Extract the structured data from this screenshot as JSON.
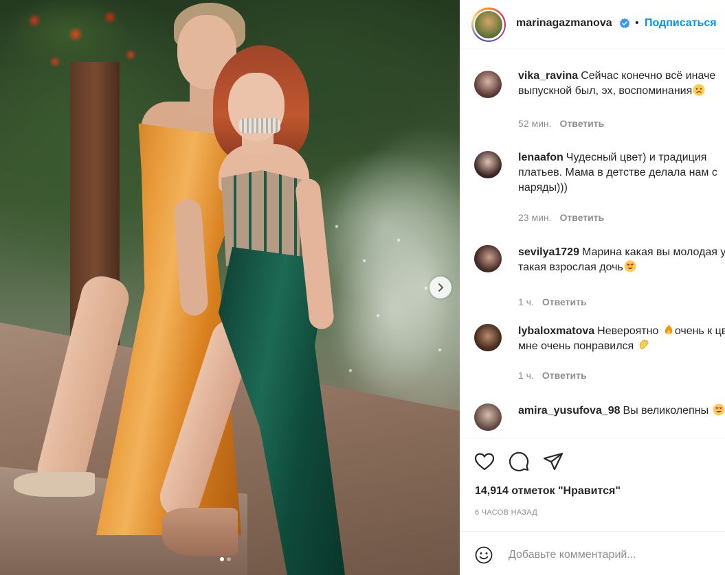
{
  "post": {
    "carousel": {
      "current": 1,
      "total": 2
    }
  },
  "header": {
    "username": "marinagazmanova",
    "separator": "•",
    "follow_label": "Подписаться"
  },
  "comments": [
    {
      "user": "vika_ravina",
      "text": "Сейчас конечно всё иначе выпускной был, эх, воспоминания",
      "emoji": "sad-face-emoji",
      "time": "52 мин.",
      "reply_label": "Ответить"
    },
    {
      "user": "lenaafon",
      "text": "Чудесный цвет) и традиция платьев. Мама в детстве делала нам с наряды)))",
      "emoji": "",
      "time": "23 мин.",
      "reply_label": "Ответить"
    },
    {
      "user": "sevilya1729",
      "text": "Марина какая вы молодая увас такая взрослая дочь",
      "emoji": "heart-eyes-emoji",
      "time": "1 ч.",
      "reply_label": "Ответить"
    },
    {
      "user": "lybaloxmatova",
      "text_a": "Невероятно",
      "text_b": "очень к цвет, мне очень понравился",
      "emoji_a": "fire-emoji",
      "emoji_b": "clapping-hands-emoji",
      "time": "1 ч.",
      "reply_label": "Ответить"
    },
    {
      "user": "amira_yusufova_98",
      "text": "Вы великолепны",
      "emoji": "heart-eyes-emoji"
    }
  ],
  "actions": {
    "icons": [
      "heart-icon",
      "comment-icon",
      "share-icon"
    ]
  },
  "likes_text": "14,914 отметок \"Нравится\"",
  "time_ago": "6 ЧАСОВ НАЗАД",
  "add_comment": {
    "placeholder": "Добавьте комментарий..."
  },
  "colors": {
    "link_blue": "#0095f6",
    "verified_blue": "#3897f0",
    "text_primary": "#262626",
    "text_secondary": "#8e8e8e"
  }
}
